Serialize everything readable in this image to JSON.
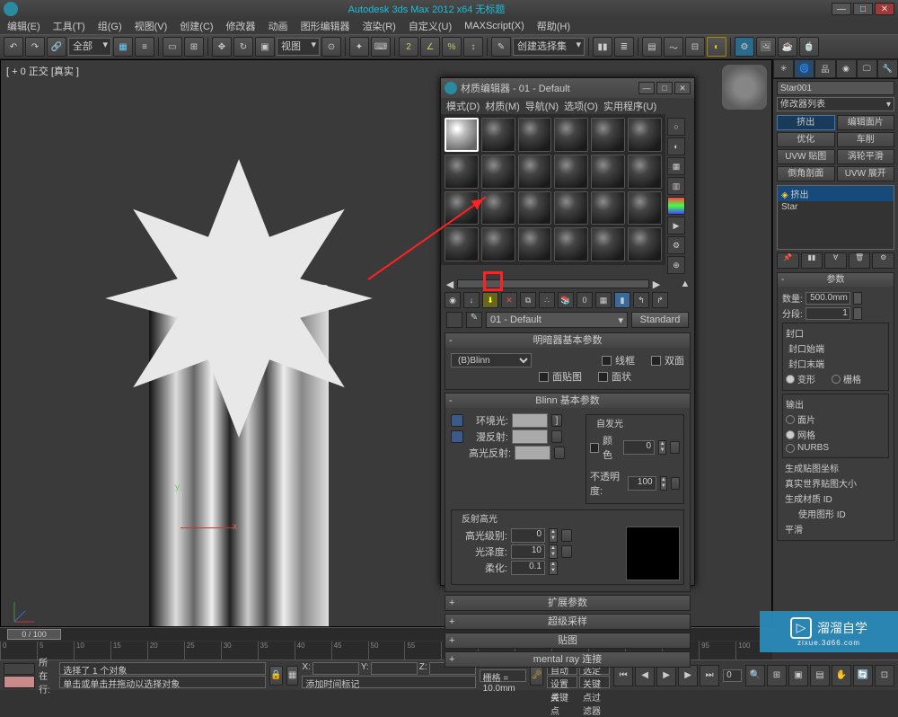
{
  "title": "Autodesk 3ds Max 2012 x64   无标题",
  "mainMenu": [
    "编辑(E)",
    "工具(T)",
    "组(G)",
    "视图(V)",
    "创建(C)",
    "修改器",
    "动画",
    "图形编辑器",
    "渲染(R)",
    "自定义(U)",
    "MAXScript(X)",
    "帮助(H)"
  ],
  "toolbar": {
    "allSel": "全部",
    "viewBtn": "视图",
    "createSel": "创建选择集"
  },
  "viewport": {
    "label": "[ + 0 正交 [真实 ]"
  },
  "frame": {
    "current": "0 / 100"
  },
  "materialEditor": {
    "title": "材质编辑器 - 01 - Default",
    "menu": [
      "模式(D)",
      "材质(M)",
      "导航(N)",
      "选项(O)",
      "实用程序(U)"
    ],
    "matName": "01 - Default",
    "matType": "Standard",
    "roll_shader": "明暗器基本参数",
    "shader": "(B)Blinn",
    "wire": "线框",
    "twoSided": "双面",
    "faceMap": "面贴图",
    "faceted": "面状",
    "roll_blinn": "Blinn 基本参数",
    "ambient": "环境光:",
    "diffuse": "漫反射:",
    "specular": "高光反射:",
    "selfIllum": "自发光",
    "color": "颜色",
    "opacity": "不透明度:",
    "opVal": "100",
    "colVal": "0",
    "reflHi": "反射高光",
    "specLevel": "高光级别:",
    "specVal": "0",
    "gloss": "光泽度:",
    "glossVal": "10",
    "soften": "柔化:",
    "softenVal": "0.1",
    "roll_ext": "扩展参数",
    "roll_ss": "超级采样",
    "roll_maps": "贴图",
    "roll_mr": "mental ray 连接"
  },
  "commandPanel": {
    "objName": "Star001",
    "modList": "修改器列表",
    "btns": [
      "挤出",
      "编辑面片",
      "优化",
      "车削",
      "UVW 贴图",
      "涡轮平滑",
      "倒角剖面",
      "UVW 展开"
    ],
    "stack": [
      "挤出",
      "Star"
    ],
    "roll_params": "参数",
    "amount": "数量:",
    "amountVal": "500.0mm",
    "segments": "分段:",
    "segVal": "1",
    "capGrp": "封口",
    "capStart": "封口始端",
    "capEnd": "封口末端",
    "morph": "变形",
    "grid": "栅格",
    "outGrp": "输出",
    "patch": "面片",
    "mesh": "网格",
    "nurbs": "NURBS",
    "genMapping": "生成贴图坐标",
    "realWorld": "真实世界贴图大小",
    "genMatID": "生成材质 ID",
    "useShapeID": "使用图形 ID",
    "smooth": "平滑"
  },
  "status": {
    "selInfo": "选择了 1 个对象",
    "hint": "单击或单击并拖动以选择对象",
    "x": "X:",
    "y": "Y:",
    "z": "Z:",
    "grid": "栅格 = 10.0mm",
    "autoKey": "自动关键点",
    "selLock": "选定对象",
    "addTime": "添加时间标记",
    "setKey": "设置关键点",
    "keyFilter": "关键点过滤器",
    "loc": "所在行:"
  },
  "watermark": {
    "brand": "溜溜自学",
    "url": "zixue.3d66.com"
  }
}
